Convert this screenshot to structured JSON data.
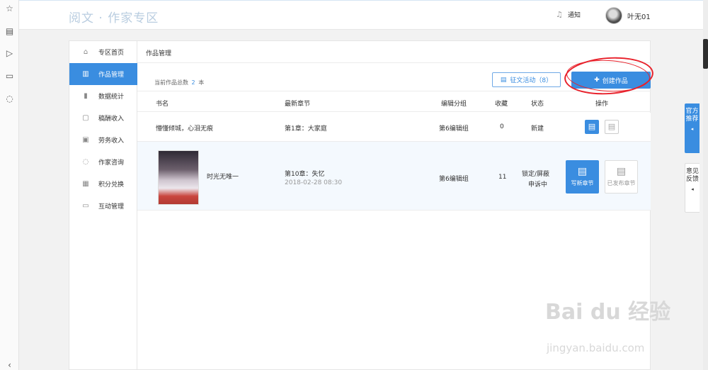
{
  "header": {
    "logo": "阅文 · 作家专区",
    "notify_label": "通知",
    "username": "叶无01"
  },
  "float_tabs": {
    "recommend": "官方推荐",
    "feedback": "意见反馈"
  },
  "sidebar": {
    "items": [
      {
        "label": "专区首页",
        "icon": "home-icon"
      },
      {
        "label": "作品管理",
        "icon": "book-icon"
      },
      {
        "label": "数据统计",
        "icon": "bar-chart-icon"
      },
      {
        "label": "稿酬收入",
        "icon": "wallet-icon"
      },
      {
        "label": "劳务收入",
        "icon": "calendar-icon"
      },
      {
        "label": "作家咨询",
        "icon": "chat-icon"
      },
      {
        "label": "积分兑换",
        "icon": "gift-icon"
      },
      {
        "label": "互动管理",
        "icon": "messages-icon"
      }
    ]
  },
  "content": {
    "breadcrumb": "作品管理",
    "total_label": "当前作品总数",
    "total_count": "2",
    "total_unit": "本",
    "activity_button": "征文活动（8）",
    "create_button": "创建作品",
    "columns": [
      "书名",
      "最新章节",
      "编辑分组",
      "收藏",
      "状态",
      "操作"
    ],
    "rows": [
      {
        "title": "懵懂倾城，心泪无痕",
        "chapter": "第1章：大家庭",
        "date": "",
        "group": "第6编辑组",
        "favorites": "0",
        "status": "新建"
      },
      {
        "title": "时光无唯一",
        "chapter": "第10章：失忆",
        "date": "2018-02-28 08:30",
        "group": "第6编辑组",
        "favorites": "11",
        "status": "锁定/屏蔽申诉中",
        "status_line1": "锁定/屏蔽",
        "status_line2": "申诉中",
        "write_button": "写新章节",
        "published_button": "已发布章节"
      }
    ]
  },
  "watermark": {
    "brand": "Bai du 经验",
    "url": "jingyan.baidu.com"
  },
  "colors": {
    "accent": "#3a8de0",
    "annotation": "#e8202a"
  }
}
